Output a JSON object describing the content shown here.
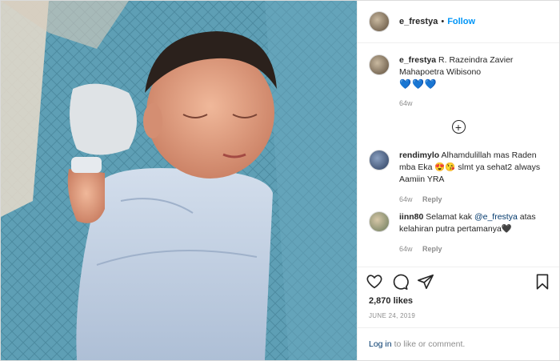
{
  "header": {
    "username": "e_frestya",
    "separator": "•",
    "follow_label": "Follow"
  },
  "caption": {
    "username": "e_frestya",
    "text": "R. Razeindra Zavier Mahapoetra Wibisono",
    "hearts": "💙💙💙",
    "time": "64w"
  },
  "load_more": {
    "icon": "plus-circle-icon",
    "glyph": "+"
  },
  "comments": [
    {
      "username": "rendimylo",
      "text": "Alhamdulillah mas Raden mba Eka 😍😘 slmt ya sehat2 always Aamiin YRA",
      "time": "64w",
      "reply_label": "Reply"
    },
    {
      "username": "iinn80",
      "text_before": "Selamat kak ",
      "mention": "@e_frestya",
      "text_after": " atas kelahiran putra pertamanya🖤",
      "time": "64w",
      "reply_label": "Reply"
    }
  ],
  "actions": {
    "icons": [
      "heart-icon",
      "comment-icon",
      "share-icon",
      "bookmark-icon"
    ]
  },
  "likes": "2,870 likes",
  "date": "JUNE 24, 2019",
  "login": {
    "link": "Log in",
    "text": "to like or comment."
  },
  "colors": {
    "accent": "#0095f6",
    "blanket": "#5e9fb5",
    "wrap": "#c9d7e8",
    "text": "#262626",
    "muted": "#8e8e8e"
  }
}
